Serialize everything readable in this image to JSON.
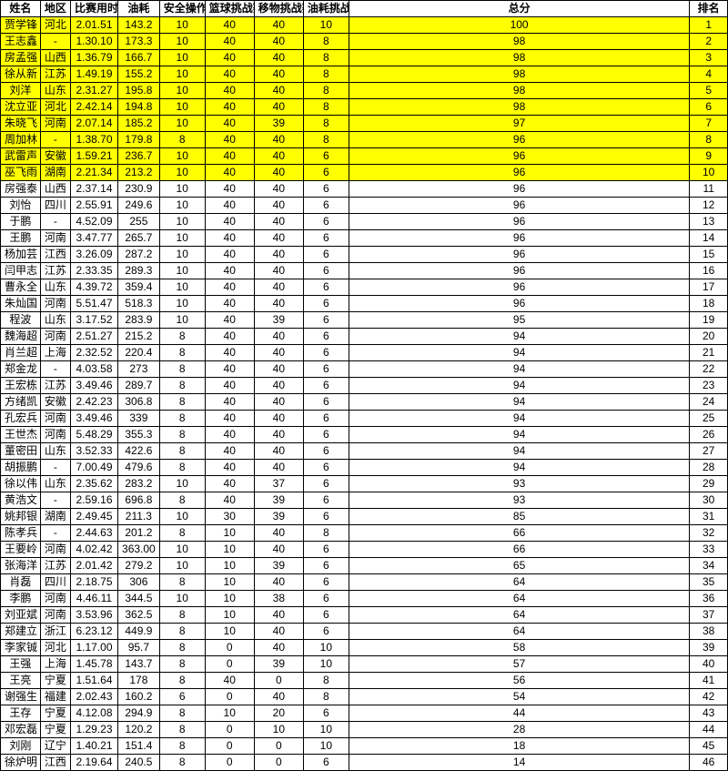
{
  "chart_data": {
    "type": "table",
    "title": "",
    "columns": [
      "姓名",
      "地区",
      "比赛用时",
      "油耗",
      "安全操作",
      "篮球挑战赛",
      "移物挑战赛",
      "油耗挑战",
      "总分",
      "排名"
    ],
    "highlight_rows": [
      0,
      1,
      2,
      3,
      4,
      5,
      6,
      7,
      8,
      9
    ],
    "rows": [
      [
        "贾学锋",
        "河北",
        "2.01.51",
        "143.2",
        "10",
        "40",
        "40",
        "10",
        "100",
        "1"
      ],
      [
        "王志鑫",
        "-",
        "1.30.10",
        "173.3",
        "10",
        "40",
        "40",
        "8",
        "98",
        "2"
      ],
      [
        "房孟强",
        "山西",
        "1.36.79",
        "166.7",
        "10",
        "40",
        "40",
        "8",
        "98",
        "3"
      ],
      [
        "徐从新",
        "江苏",
        "1.49.19",
        "155.2",
        "10",
        "40",
        "40",
        "8",
        "98",
        "4"
      ],
      [
        "刘洋",
        "山东",
        "2.31.27",
        "195.8",
        "10",
        "40",
        "40",
        "8",
        "98",
        "5"
      ],
      [
        "沈立亚",
        "河北",
        "2.42.14",
        "194.8",
        "10",
        "40",
        "40",
        "8",
        "98",
        "6"
      ],
      [
        "朱晓飞",
        "河南",
        "2.07.14",
        "185.2",
        "10",
        "40",
        "39",
        "8",
        "97",
        "7"
      ],
      [
        "周加林",
        "-",
        "1.38.70",
        "179.8",
        "8",
        "40",
        "40",
        "8",
        "96",
        "8"
      ],
      [
        "武雷声",
        "安徽",
        "1.59.21",
        "236.7",
        "10",
        "40",
        "40",
        "6",
        "96",
        "9"
      ],
      [
        "巫飞雨",
        "湖南",
        "2.21.34",
        "213.2",
        "10",
        "40",
        "40",
        "6",
        "96",
        "10"
      ],
      [
        "房强泰",
        "山西",
        "2.37.14",
        "230.9",
        "10",
        "40",
        "40",
        "6",
        "96",
        "11"
      ],
      [
        "刘怡",
        "四川",
        "2.55.91",
        "249.6",
        "10",
        "40",
        "40",
        "6",
        "96",
        "12"
      ],
      [
        "于鹏",
        "-",
        "4.52.09",
        "255",
        "10",
        "40",
        "40",
        "6",
        "96",
        "13"
      ],
      [
        "王鹏",
        "河南",
        "3.47.77",
        "265.7",
        "10",
        "40",
        "40",
        "6",
        "96",
        "14"
      ],
      [
        "杨加芸",
        "江西",
        "3.26.09",
        "287.2",
        "10",
        "40",
        "40",
        "6",
        "96",
        "15"
      ],
      [
        "闫甲志",
        "江苏",
        "2.33.35",
        "289.3",
        "10",
        "40",
        "40",
        "6",
        "96",
        "16"
      ],
      [
        "曹永全",
        "山东",
        "4.39.72",
        "359.4",
        "10",
        "40",
        "40",
        "6",
        "96",
        "17"
      ],
      [
        "朱灿国",
        "河南",
        "5.51.47",
        "518.3",
        "10",
        "40",
        "40",
        "6",
        "96",
        "18"
      ],
      [
        "程波",
        "山东",
        "3.17.52",
        "283.9",
        "10",
        "40",
        "39",
        "6",
        "95",
        "19"
      ],
      [
        "魏海超",
        "河南",
        "2.51.27",
        "215.2",
        "8",
        "40",
        "40",
        "6",
        "94",
        "20"
      ],
      [
        "肖兰超",
        "上海",
        "2.32.52",
        "220.4",
        "8",
        "40",
        "40",
        "6",
        "94",
        "21"
      ],
      [
        "郑金龙",
        "-",
        "4.03.58",
        "273",
        "8",
        "40",
        "40",
        "6",
        "94",
        "22"
      ],
      [
        "王宏栋",
        "江苏",
        "3.49.46",
        "289.7",
        "8",
        "40",
        "40",
        "6",
        "94",
        "23"
      ],
      [
        "方绪凯",
        "安徽",
        "2.42.23",
        "306.8",
        "8",
        "40",
        "40",
        "6",
        "94",
        "24"
      ],
      [
        "孔宏兵",
        "河南",
        "3.49.46",
        "339",
        "8",
        "40",
        "40",
        "6",
        "94",
        "25"
      ],
      [
        "王世杰",
        "河南",
        "5.48.29",
        "355.3",
        "8",
        "40",
        "40",
        "6",
        "94",
        "26"
      ],
      [
        "董密田",
        "山东",
        "3.52.33",
        "422.6",
        "8",
        "40",
        "40",
        "6",
        "94",
        "27"
      ],
      [
        "胡振鹏",
        "-",
        "7.00.49",
        "479.6",
        "8",
        "40",
        "40",
        "6",
        "94",
        "28"
      ],
      [
        "徐以伟",
        "山东",
        "2.35.62",
        "283.2",
        "10",
        "40",
        "37",
        "6",
        "93",
        "29"
      ],
      [
        "黄浩文",
        "-",
        "2.59.16",
        "696.8",
        "8",
        "40",
        "39",
        "6",
        "93",
        "30"
      ],
      [
        "姚邦银",
        "湖南",
        "2.49.45",
        "211.3",
        "10",
        "30",
        "39",
        "6",
        "85",
        "31"
      ],
      [
        "陈孝兵",
        "-",
        "2.44.63",
        "201.2",
        "8",
        "10",
        "40",
        "8",
        "66",
        "32"
      ],
      [
        "王要岭",
        "河南",
        "4.02.42",
        "363.00",
        "10",
        "10",
        "40",
        "6",
        "66",
        "33"
      ],
      [
        "张海洋",
        "江苏",
        "2.01.42",
        "279.2",
        "10",
        "10",
        "39",
        "6",
        "65",
        "34"
      ],
      [
        "肖磊",
        "四川",
        "2.18.75",
        "306",
        "8",
        "10",
        "40",
        "6",
        "64",
        "35"
      ],
      [
        "李鹏",
        "河南",
        "4.46.11",
        "344.5",
        "10",
        "10",
        "38",
        "6",
        "64",
        "36"
      ],
      [
        "刘亚斌",
        "河南",
        "3.53.96",
        "362.5",
        "8",
        "10",
        "40",
        "6",
        "64",
        "37"
      ],
      [
        "郑建立",
        "浙江",
        "6.23.12",
        "449.9",
        "8",
        "10",
        "40",
        "6",
        "64",
        "38"
      ],
      [
        "李家铖",
        "河北",
        "1.17.00",
        "95.7",
        "8",
        "0",
        "40",
        "10",
        "58",
        "39"
      ],
      [
        "王强",
        "上海",
        "1.45.78",
        "143.7",
        "8",
        "0",
        "39",
        "10",
        "57",
        "40"
      ],
      [
        "王亮",
        "宁夏",
        "1.51.64",
        "178",
        "8",
        "40",
        "0",
        "8",
        "56",
        "41"
      ],
      [
        "谢强生",
        "福建",
        "2.02.43",
        "160.2",
        "6",
        "0",
        "40",
        "8",
        "54",
        "42"
      ],
      [
        "王存",
        "宁夏",
        "4.12.08",
        "294.9",
        "8",
        "10",
        "20",
        "6",
        "44",
        "43"
      ],
      [
        "邓宏磊",
        "宁夏",
        "1.29.23",
        "120.2",
        "8",
        "0",
        "10",
        "10",
        "28",
        "44"
      ],
      [
        "刘刚",
        "辽宁",
        "1.40.21",
        "151.4",
        "8",
        "0",
        "0",
        "10",
        "18",
        "45"
      ],
      [
        "徐炉明",
        "江西",
        "2.19.64",
        "240.5",
        "8",
        "0",
        "0",
        "6",
        "14",
        "46"
      ]
    ]
  }
}
